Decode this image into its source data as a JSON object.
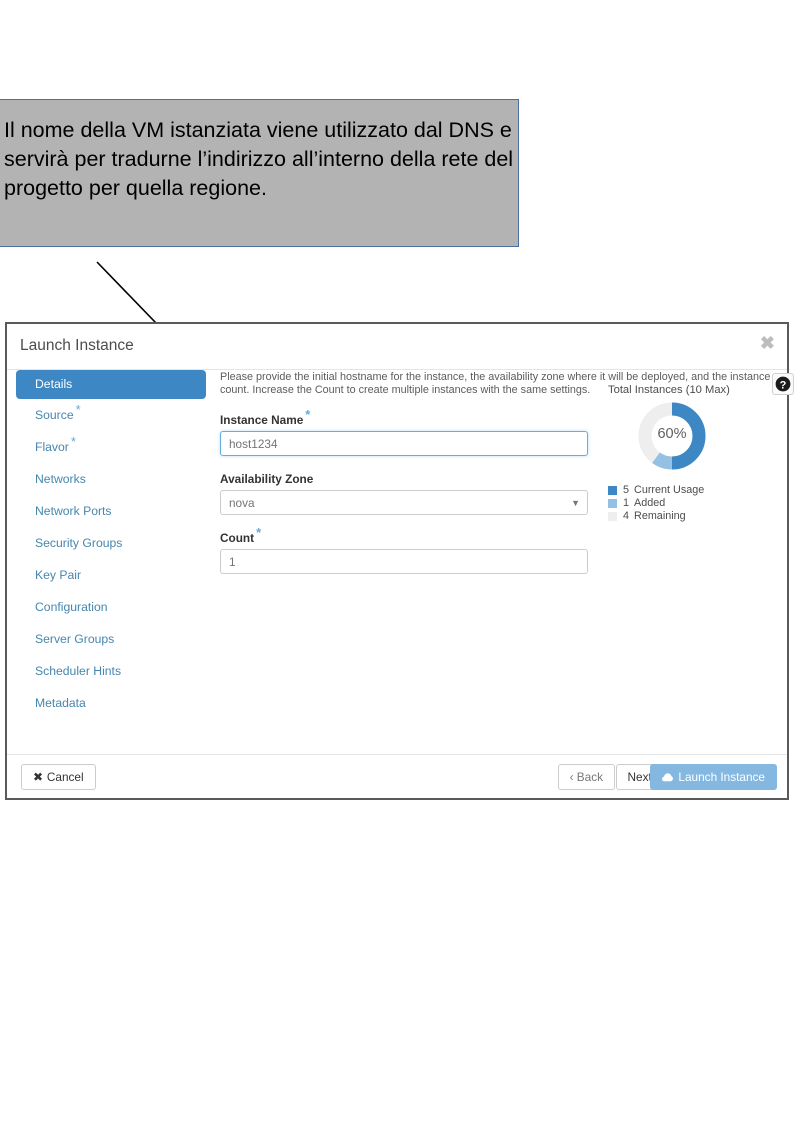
{
  "callout": {
    "text": "Il nome della VM istanziata viene utilizzato dal DNS e servirà per tradurne l’indirizzo all’interno della rete del progetto per quella regione.",
    "background_color": "#b3b3b3",
    "border_color": "#4a6fa5"
  },
  "dialog": {
    "title": "Launch Instance",
    "close_label": "✖",
    "accent_color": "#3c87c4"
  },
  "wizard_nav": {
    "items": [
      {
        "label": "Details",
        "required": false,
        "active": true
      },
      {
        "label": "Source",
        "required": true,
        "active": false
      },
      {
        "label": "Flavor",
        "required": true,
        "active": false
      },
      {
        "label": "Networks",
        "required": false,
        "active": false
      },
      {
        "label": "Network Ports",
        "required": false,
        "active": false
      },
      {
        "label": "Security Groups",
        "required": false,
        "active": false
      },
      {
        "label": "Key Pair",
        "required": false,
        "active": false
      },
      {
        "label": "Configuration",
        "required": false,
        "active": false
      },
      {
        "label": "Server Groups",
        "required": false,
        "active": false
      },
      {
        "label": "Scheduler Hints",
        "required": false,
        "active": false
      },
      {
        "label": "Metadata",
        "required": false,
        "active": false
      }
    ]
  },
  "form": {
    "description": "Please provide the initial hostname for the instance, the availability zone where it will be deployed, and the instance count. Increase the Count to create multiple instances with the same settings.",
    "instance_name": {
      "label": "Instance Name",
      "required_marker": "*",
      "value": "",
      "placeholder": "host1234"
    },
    "availability_zone": {
      "label": "Availability Zone",
      "selected": "nova",
      "options": [
        "nova"
      ],
      "caret": "▼"
    },
    "count": {
      "label": "Count",
      "required_marker": "*",
      "value": "",
      "placeholder": "1"
    },
    "help_icon": "?"
  },
  "chart_data": {
    "type": "pie",
    "title": "Total Instances (10 Max)",
    "center_label": "60%",
    "max": 10,
    "categories": [
      "Current Usage",
      "Added",
      "Remaining"
    ],
    "values": [
      5,
      1,
      4
    ],
    "colors": [
      "#3c87c4",
      "#93c0e3",
      "#eeeeee"
    ],
    "legend": [
      {
        "value": "5",
        "label": "Current Usage",
        "color": "#3c87c4"
      },
      {
        "value": "1",
        "label": "Added",
        "color": "#93c0e3"
      },
      {
        "value": "4",
        "label": "Remaining",
        "color": "#eeeeee"
      }
    ],
    "legend_position": "below",
    "grid": false
  },
  "footer": {
    "cancel_label": "Cancel",
    "cancel_icon": "✖",
    "back_label": "‹ Back",
    "next_label": "Next ›",
    "launch_label": "Launch Instance",
    "launch_icon": "cloud-icon"
  }
}
